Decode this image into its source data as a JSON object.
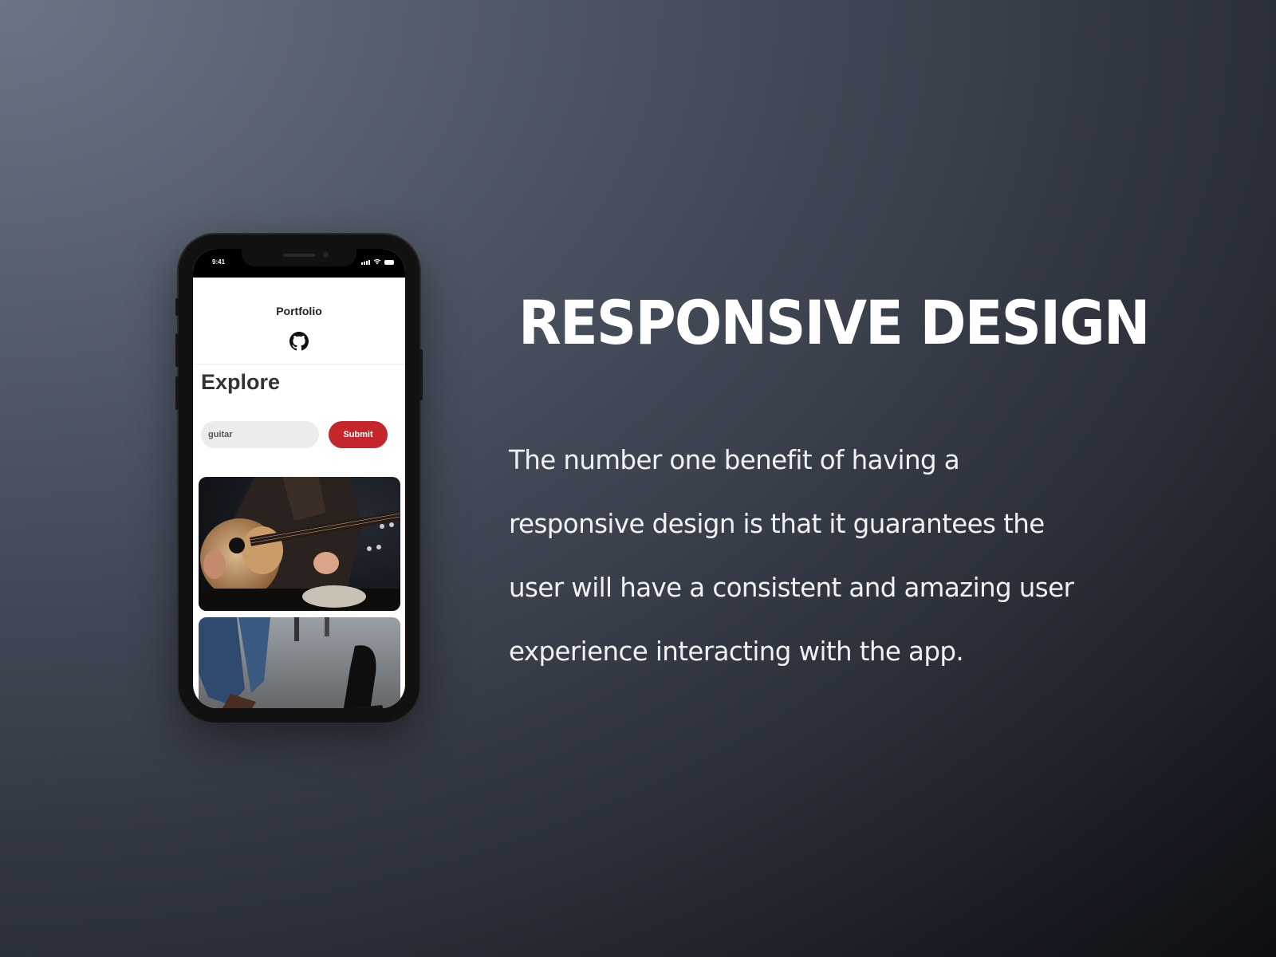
{
  "phone": {
    "status_time": "9:41",
    "app_title": "Portfolio",
    "explore_heading": "Explore",
    "search": {
      "value": "guitar"
    },
    "submit_label": "Submit",
    "icons": [
      "github-icon",
      "signal-icon",
      "wifi-icon",
      "battery-icon"
    ],
    "images": [
      "guitar-player-photo",
      "guitar-case-street-photo"
    ]
  },
  "headline": "RESPONSIVE DESIGN",
  "body": "The number one benefit of having a responsive design is that it guarantees the user will have a consistent and amazing user experience interacting with the app.",
  "colors": {
    "accent": "#c4262c",
    "background": "#3a404b",
    "text": "#ffffff"
  }
}
